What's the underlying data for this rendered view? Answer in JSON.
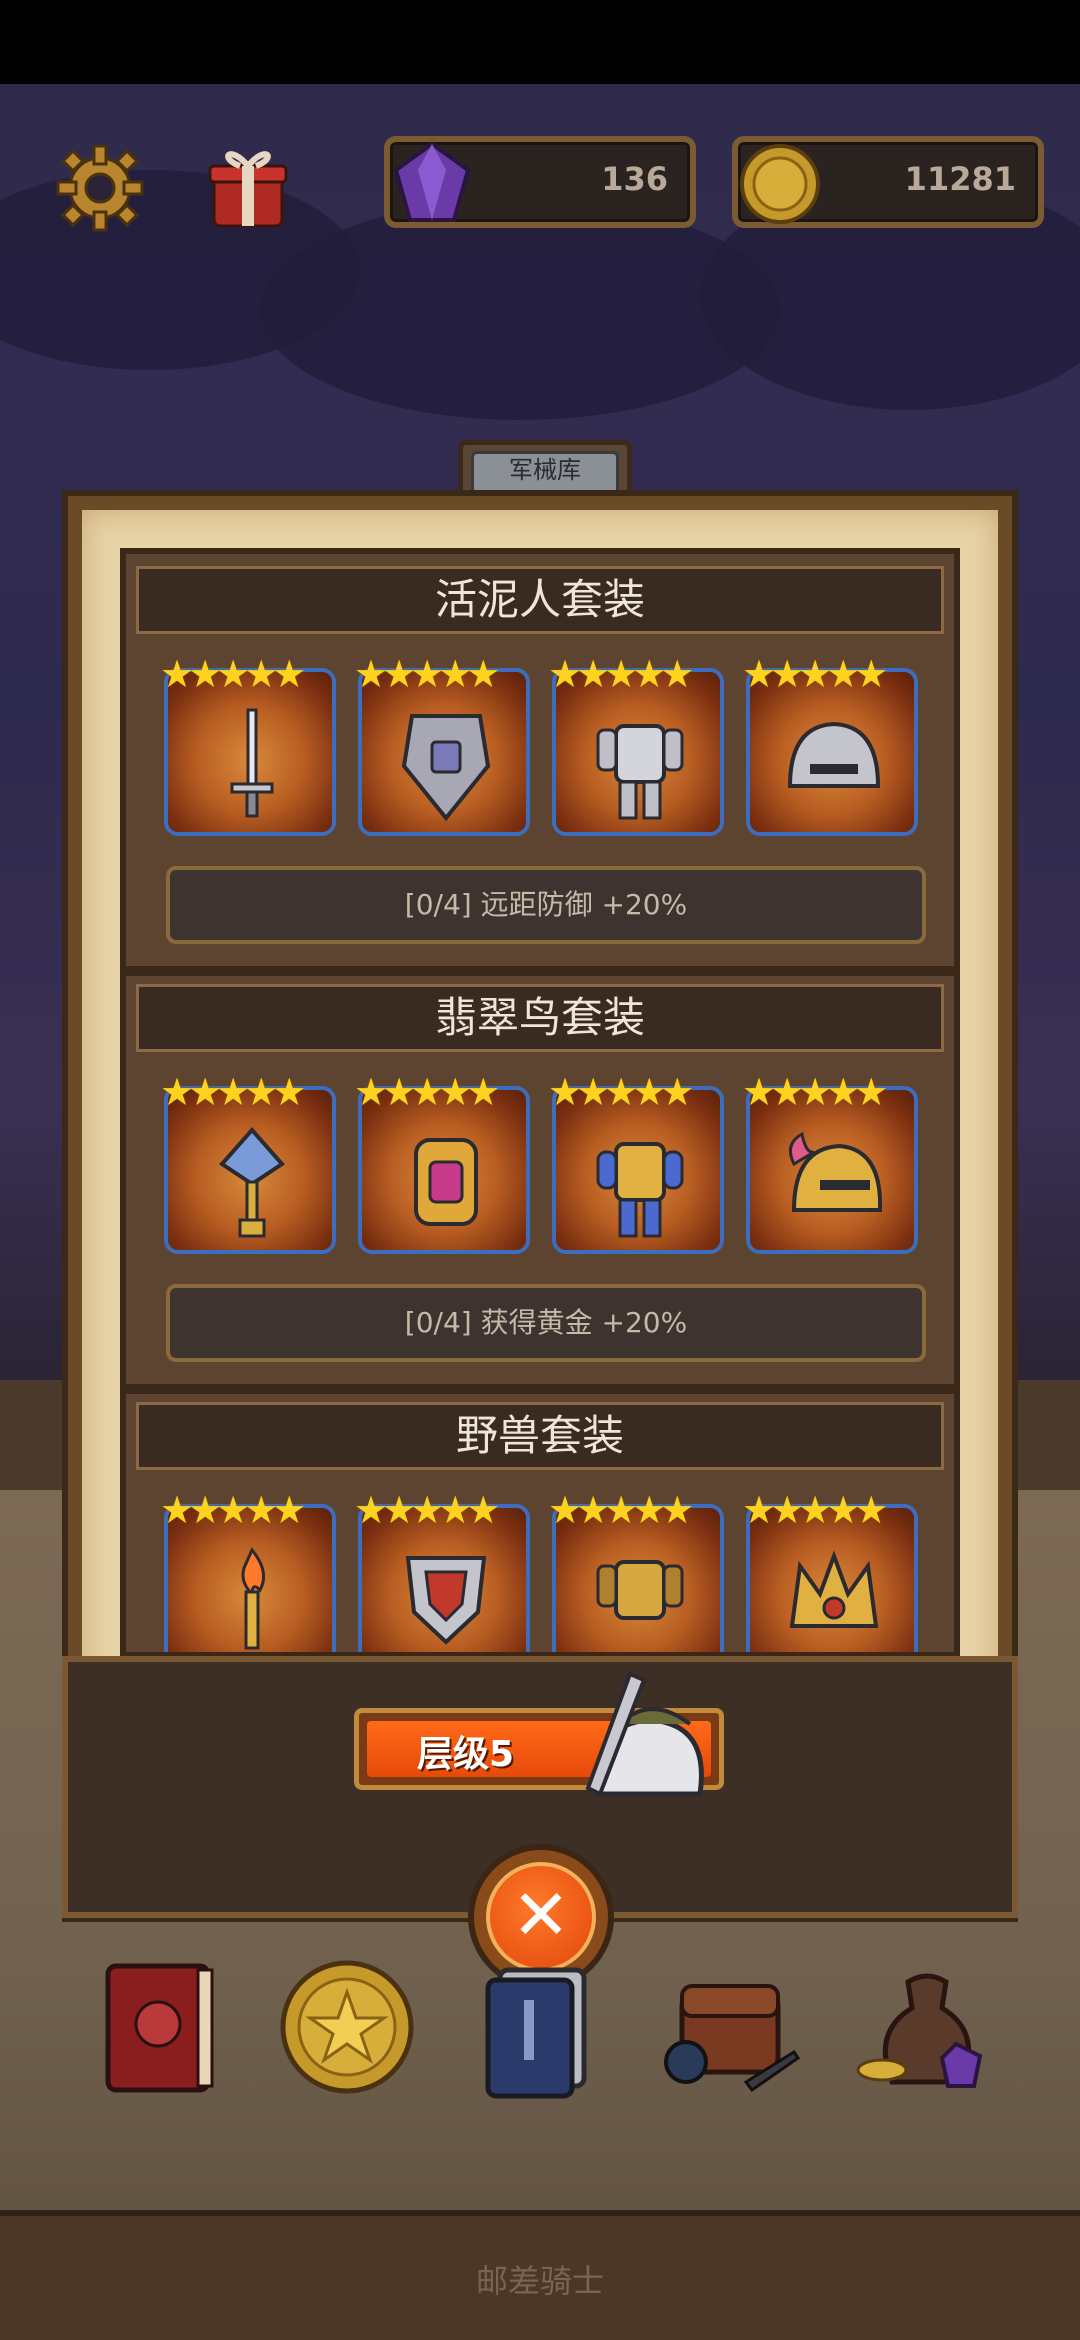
{
  "resources": {
    "gems": "136",
    "coins": "11281"
  },
  "panel": {
    "tab_label": "军械库"
  },
  "sets": [
    {
      "title": "活泥人套装",
      "bonus": "[0/4] 远距防御 +20%",
      "stars": [
        "★★★★★",
        "★★★★★",
        "★★★★★",
        "★★★★★"
      ],
      "items": [
        "sword",
        "shield",
        "armor",
        "helmet"
      ]
    },
    {
      "title": "翡翠鸟套装",
      "bonus": "[0/4] 获得黄金 +20%",
      "stars": [
        "★★★★★",
        "★★★★★",
        "★★★★★",
        "★★★★★"
      ],
      "items": [
        "scepter",
        "amulet",
        "armor",
        "helmet"
      ]
    },
    {
      "title": "野兽套装",
      "stars": [
        "★★★★★",
        "★★★★★",
        "★★★★★",
        "★★★★★"
      ],
      "items": [
        "torch",
        "emblem",
        "armor",
        "crown"
      ]
    }
  ],
  "level_button": {
    "label": "层级5"
  },
  "footer": {
    "text": "邮差骑士"
  },
  "colors": {
    "accent_orange": "#ff6a18",
    "slot_border": "#3d6dbf",
    "star": "#ffd21f"
  }
}
